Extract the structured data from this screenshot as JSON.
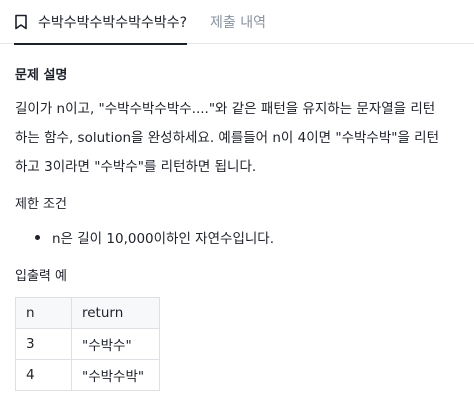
{
  "tabs": [
    {
      "label": "수박수박수박수박수박수?",
      "active": true,
      "icon": "bookmark-icon"
    },
    {
      "label": "제출 내역",
      "active": false
    }
  ],
  "problem": {
    "heading": "문제 설명",
    "lines": [
      "길이가 n이고, \"수박수박수박수....\"와 같은 패턴을 유지하는 문자열을 리턴",
      "하는 함수, solution을 완성하세요. 예를들어 n이 4이면 \"수박수박\"을 리턴",
      "하고 3이라면 \"수박수\"를 리턴하면 됩니다."
    ]
  },
  "constraints": {
    "heading": "제한 조건",
    "items": [
      "n은 길이 10,000이하인 자연수입니다."
    ]
  },
  "examples": {
    "heading": "입출력 예",
    "columns": [
      "n",
      "return"
    ],
    "rows": [
      [
        "3",
        "\"수박수\""
      ],
      [
        "4",
        "\"수박수박\""
      ]
    ]
  },
  "colors": {
    "text": "#1d2129",
    "muted": "#8a93a0",
    "border": "#dde1e6"
  }
}
